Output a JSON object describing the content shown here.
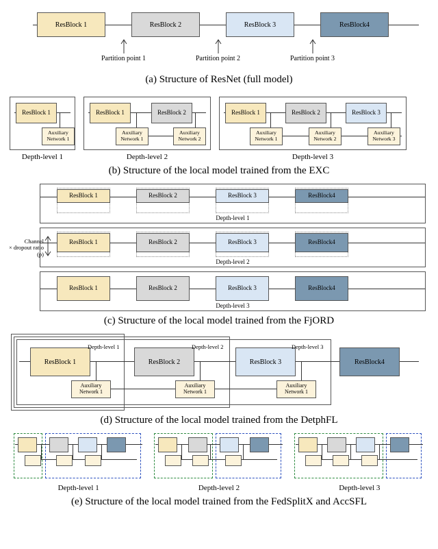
{
  "blocks": {
    "b1": "ResBlock 1",
    "b2": "ResBlock 2",
    "b3": "ResBlock 3",
    "b4": "ResBlock4",
    "a1": "Auxiliary Network 1",
    "a2": "Auxiliary Network 2",
    "a3": "Auxiliary Network 3"
  },
  "panelA": {
    "caption": "(a) Structure of ResNet (full model)",
    "pp1": "Partition point 1",
    "pp2": "Partition point 2",
    "pp3": "Partition point 3"
  },
  "panelB": {
    "caption": "(b) Structure of the local model trained from the EXC",
    "dl1": "Depth-level 1",
    "dl2": "Depth-level 2",
    "dl3": "Depth-level 3"
  },
  "panelC": {
    "caption": "(c) Structure of the local model trained from the FjORD",
    "dl1": "Depth-level 1",
    "dl2": "Depth-level 2",
    "dl3": "Depth-level 3",
    "channel_label": "Channel\n× dropout ratio (p)"
  },
  "panelD": {
    "caption": "(d) Structure of the local model trained from the DetphFL",
    "dl1": "Depth-level 1",
    "dl2": "Depth-level 2",
    "dl3": "Depth-level 3"
  },
  "panelE": {
    "caption": "(e) Structure of the local model trained from the FedSplitX and AccSFL",
    "dl1": "Depth-level 1",
    "dl2": "Depth-level 2",
    "dl3": "Depth-level 3"
  }
}
